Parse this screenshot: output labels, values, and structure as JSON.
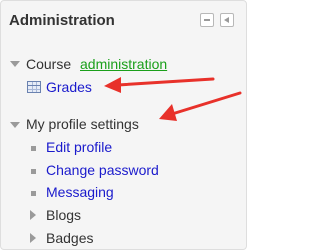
{
  "block": {
    "title": "Administration",
    "dock_icon": "dock-icon",
    "hide_icon": "collapse-left-icon"
  },
  "course": {
    "label_prefix": "Course ",
    "link_label": "administration",
    "grades_label": "Grades",
    "grades_icon": "grades-table-icon"
  },
  "profile": {
    "label": "My profile settings",
    "items": [
      "Edit profile",
      "Change password",
      "Messaging"
    ],
    "collapsed": [
      "Blogs",
      "Badges"
    ]
  },
  "annotations": {
    "arrow_color": "#e8312a"
  },
  "colors": {
    "link": "#1a1acc",
    "course_link": "#1a9f1a",
    "text": "#333333",
    "block_bg": "#f5f5f5"
  }
}
